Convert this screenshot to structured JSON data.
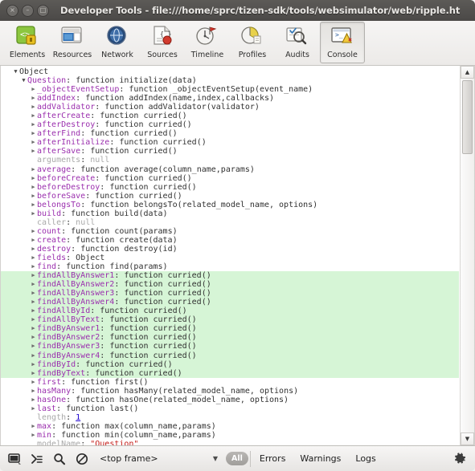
{
  "window": {
    "title": "Developer Tools - file:///home/sprc/tizen-sdk/tools/websimulator/web/ripple.ht",
    "close_label": "×",
    "minimize_label": "–",
    "maximize_label": "□"
  },
  "toolbar": {
    "tabs": [
      {
        "label": "Elements",
        "icon": "elements-icon",
        "active": false
      },
      {
        "label": "Resources",
        "icon": "resources-icon",
        "active": false
      },
      {
        "label": "Network",
        "icon": "network-icon",
        "active": false
      },
      {
        "label": "Sources",
        "icon": "sources-icon",
        "active": false
      },
      {
        "label": "Timeline",
        "icon": "timeline-icon",
        "active": false
      },
      {
        "label": "Profiles",
        "icon": "profiles-icon",
        "active": false
      },
      {
        "label": "Audits",
        "icon": "audits-icon",
        "active": false
      },
      {
        "label": "Console",
        "icon": "console-icon",
        "active": true
      }
    ]
  },
  "console": {
    "rows": [
      {
        "indent": 0,
        "tri": "open",
        "key": "Object",
        "sep": "",
        "value": "",
        "vclass": "plain",
        "kclass": "plain",
        "hl": false
      },
      {
        "indent": 1,
        "tri": "open",
        "key": "Question",
        "sep": ": ",
        "value": "function initialize(data)",
        "vclass": "plain",
        "kclass": "key",
        "hl": false
      },
      {
        "indent": 2,
        "tri": "closed",
        "key": "_objectEventSetup",
        "sep": ": ",
        "value": "function _objectEventSetup(event_name)",
        "vclass": "plain",
        "kclass": "key",
        "hl": false
      },
      {
        "indent": 2,
        "tri": "closed",
        "key": "addIndex",
        "sep": ": ",
        "value": "function addIndex(name,index,callbacks)",
        "vclass": "plain",
        "kclass": "key",
        "hl": false
      },
      {
        "indent": 2,
        "tri": "closed",
        "key": "addValidator",
        "sep": ": ",
        "value": "function addValidator(validator)",
        "vclass": "plain",
        "kclass": "key",
        "hl": false
      },
      {
        "indent": 2,
        "tri": "closed",
        "key": "afterCreate",
        "sep": ": ",
        "value": "function curried()",
        "vclass": "plain",
        "kclass": "key",
        "hl": false
      },
      {
        "indent": 2,
        "tri": "closed",
        "key": "afterDestroy",
        "sep": ": ",
        "value": "function curried()",
        "vclass": "plain",
        "kclass": "key",
        "hl": false
      },
      {
        "indent": 2,
        "tri": "closed",
        "key": "afterFind",
        "sep": ": ",
        "value": "function curried()",
        "vclass": "plain",
        "kclass": "key",
        "hl": false
      },
      {
        "indent": 2,
        "tri": "closed",
        "key": "afterInitialize",
        "sep": ": ",
        "value": "function curried()",
        "vclass": "plain",
        "kclass": "key",
        "hl": false
      },
      {
        "indent": 2,
        "tri": "closed",
        "key": "afterSave",
        "sep": ": ",
        "value": "function curried()",
        "vclass": "plain",
        "kclass": "key",
        "hl": false
      },
      {
        "indent": 2,
        "tri": "blank",
        "key": "arguments",
        "sep": ": ",
        "value": "null",
        "vclass": "nul",
        "kclass": "dim",
        "hl": false
      },
      {
        "indent": 2,
        "tri": "closed",
        "key": "average",
        "sep": ": ",
        "value": "function average(column_name,params)",
        "vclass": "plain",
        "kclass": "key",
        "hl": false
      },
      {
        "indent": 2,
        "tri": "closed",
        "key": "beforeCreate",
        "sep": ": ",
        "value": "function curried()",
        "vclass": "plain",
        "kclass": "key",
        "hl": false
      },
      {
        "indent": 2,
        "tri": "closed",
        "key": "beforeDestroy",
        "sep": ": ",
        "value": "function curried()",
        "vclass": "plain",
        "kclass": "key",
        "hl": false
      },
      {
        "indent": 2,
        "tri": "closed",
        "key": "beforeSave",
        "sep": ": ",
        "value": "function curried()",
        "vclass": "plain",
        "kclass": "key",
        "hl": false
      },
      {
        "indent": 2,
        "tri": "closed",
        "key": "belongsTo",
        "sep": ": ",
        "value": "function belongsTo(related_model_name, options)",
        "vclass": "plain",
        "kclass": "key",
        "hl": false
      },
      {
        "indent": 2,
        "tri": "closed",
        "key": "build",
        "sep": ": ",
        "value": "function build(data)",
        "vclass": "plain",
        "kclass": "key",
        "hl": false
      },
      {
        "indent": 2,
        "tri": "blank",
        "key": "caller",
        "sep": ": ",
        "value": "null",
        "vclass": "nul",
        "kclass": "dim",
        "hl": false
      },
      {
        "indent": 2,
        "tri": "closed",
        "key": "count",
        "sep": ": ",
        "value": "function count(params)",
        "vclass": "plain",
        "kclass": "key",
        "hl": false
      },
      {
        "indent": 2,
        "tri": "closed",
        "key": "create",
        "sep": ": ",
        "value": "function create(data)",
        "vclass": "plain",
        "kclass": "key",
        "hl": false
      },
      {
        "indent": 2,
        "tri": "closed",
        "key": "destroy",
        "sep": ": ",
        "value": "function destroy(id)",
        "vclass": "plain",
        "kclass": "key",
        "hl": false
      },
      {
        "indent": 2,
        "tri": "closed",
        "key": "fields",
        "sep": ": ",
        "value": "Object",
        "vclass": "plain",
        "kclass": "key",
        "hl": false
      },
      {
        "indent": 2,
        "tri": "closed",
        "key": "find",
        "sep": ": ",
        "value": "function find(params)",
        "vclass": "plain",
        "kclass": "key",
        "hl": false
      },
      {
        "indent": 2,
        "tri": "closed",
        "key": "findAllByAnswer1",
        "sep": ": ",
        "value": "function curried()",
        "vclass": "plain",
        "kclass": "key",
        "hl": true
      },
      {
        "indent": 2,
        "tri": "closed",
        "key": "findAllByAnswer2",
        "sep": ": ",
        "value": "function curried()",
        "vclass": "plain",
        "kclass": "key",
        "hl": true
      },
      {
        "indent": 2,
        "tri": "closed",
        "key": "findAllByAnswer3",
        "sep": ": ",
        "value": "function curried()",
        "vclass": "plain",
        "kclass": "key",
        "hl": true
      },
      {
        "indent": 2,
        "tri": "closed",
        "key": "findAllByAnswer4",
        "sep": ": ",
        "value": "function curried()",
        "vclass": "plain",
        "kclass": "key",
        "hl": true
      },
      {
        "indent": 2,
        "tri": "closed",
        "key": "findAllById",
        "sep": ": ",
        "value": "function curried()",
        "vclass": "plain",
        "kclass": "key",
        "hl": true
      },
      {
        "indent": 2,
        "tri": "closed",
        "key": "findAllByText",
        "sep": ": ",
        "value": "function curried()",
        "vclass": "plain",
        "kclass": "key",
        "hl": true
      },
      {
        "indent": 2,
        "tri": "closed",
        "key": "findByAnswer1",
        "sep": ": ",
        "value": "function curried()",
        "vclass": "plain",
        "kclass": "key",
        "hl": true
      },
      {
        "indent": 2,
        "tri": "closed",
        "key": "findByAnswer2",
        "sep": ": ",
        "value": "function curried()",
        "vclass": "plain",
        "kclass": "key",
        "hl": true
      },
      {
        "indent": 2,
        "tri": "closed",
        "key": "findByAnswer3",
        "sep": ": ",
        "value": "function curried()",
        "vclass": "plain",
        "kclass": "key",
        "hl": true
      },
      {
        "indent": 2,
        "tri": "closed",
        "key": "findByAnswer4",
        "sep": ": ",
        "value": "function curried()",
        "vclass": "plain",
        "kclass": "key",
        "hl": true
      },
      {
        "indent": 2,
        "tri": "closed",
        "key": "findById",
        "sep": ": ",
        "value": "function curried()",
        "vclass": "plain",
        "kclass": "key",
        "hl": true
      },
      {
        "indent": 2,
        "tri": "closed",
        "key": "findByText",
        "sep": ": ",
        "value": "function curried()",
        "vclass": "plain",
        "kclass": "key",
        "hl": true
      },
      {
        "indent": 2,
        "tri": "closed",
        "key": "first",
        "sep": ": ",
        "value": "function first()",
        "vclass": "plain",
        "kclass": "key",
        "hl": false
      },
      {
        "indent": 2,
        "tri": "closed",
        "key": "hasMany",
        "sep": ": ",
        "value": "function hasMany(related_model_name, options)",
        "vclass": "plain",
        "kclass": "key",
        "hl": false
      },
      {
        "indent": 2,
        "tri": "closed",
        "key": "hasOne",
        "sep": ": ",
        "value": "function hasOne(related_model_name, options)",
        "vclass": "plain",
        "kclass": "key",
        "hl": false
      },
      {
        "indent": 2,
        "tri": "closed",
        "key": "last",
        "sep": ": ",
        "value": "function last()",
        "vclass": "plain",
        "kclass": "key",
        "hl": false
      },
      {
        "indent": 2,
        "tri": "blank",
        "key": "length",
        "sep": ": ",
        "value": "1",
        "vclass": "num",
        "kclass": "dim",
        "hl": false
      },
      {
        "indent": 2,
        "tri": "closed",
        "key": "max",
        "sep": ": ",
        "value": "function max(column_name,params)",
        "vclass": "plain",
        "kclass": "key",
        "hl": false
      },
      {
        "indent": 2,
        "tri": "closed",
        "key": "min",
        "sep": ": ",
        "value": "function min(column_name,params)",
        "vclass": "plain",
        "kclass": "key",
        "hl": false
      },
      {
        "indent": 2,
        "tri": "blank",
        "key": "modelName",
        "sep": ": ",
        "value": "\"Question\"",
        "vclass": "str",
        "kclass": "dim",
        "hl": false
      }
    ],
    "triangle_open": "▼",
    "triangle_closed": "▶"
  },
  "statusbar": {
    "dock_icon": "dock-window-icon",
    "prompt_icon": "console-prompt-icon",
    "search_icon": "search-icon",
    "clear_icon": "clear-console-icon",
    "frame_value": "<top frame>",
    "frame_caret": "▼",
    "all_badge": "All",
    "filters": [
      "Errors",
      "Warnings",
      "Logs"
    ],
    "gear_icon": "settings-gear-icon"
  },
  "colors": {
    "highlight_green": "#d6f5d6",
    "property_purple": "#9b2fae",
    "string_red": "#c41a16",
    "number_blue": "#1c00cf",
    "titlebar_gray": "#4b4947"
  }
}
